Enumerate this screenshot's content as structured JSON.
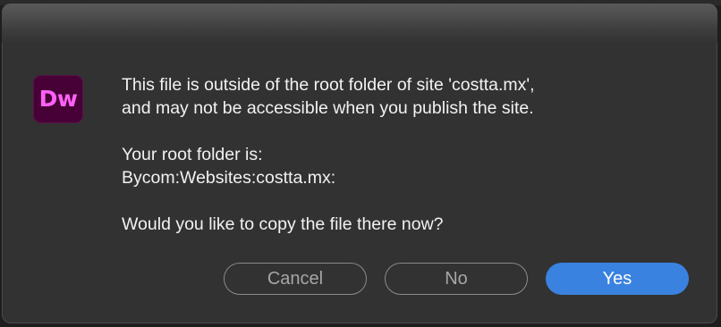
{
  "dialog": {
    "app_icon_text": "Dw",
    "message": {
      "line1": "This file is outside of the root folder of site 'costta.mx',",
      "line2": "and may not be accessible when you publish the site.",
      "root_label": "Your root folder is:",
      "root_path": "Bycom:Websites:costta.mx:",
      "question": "Would you like to copy the file there now?"
    },
    "buttons": {
      "cancel": "Cancel",
      "no": "No",
      "yes": "Yes"
    }
  },
  "colors": {
    "dialog_bg": "#323232",
    "app_icon_bg": "#470137",
    "app_icon_text": "#ff61f6",
    "primary_button": "#3a82e0"
  }
}
